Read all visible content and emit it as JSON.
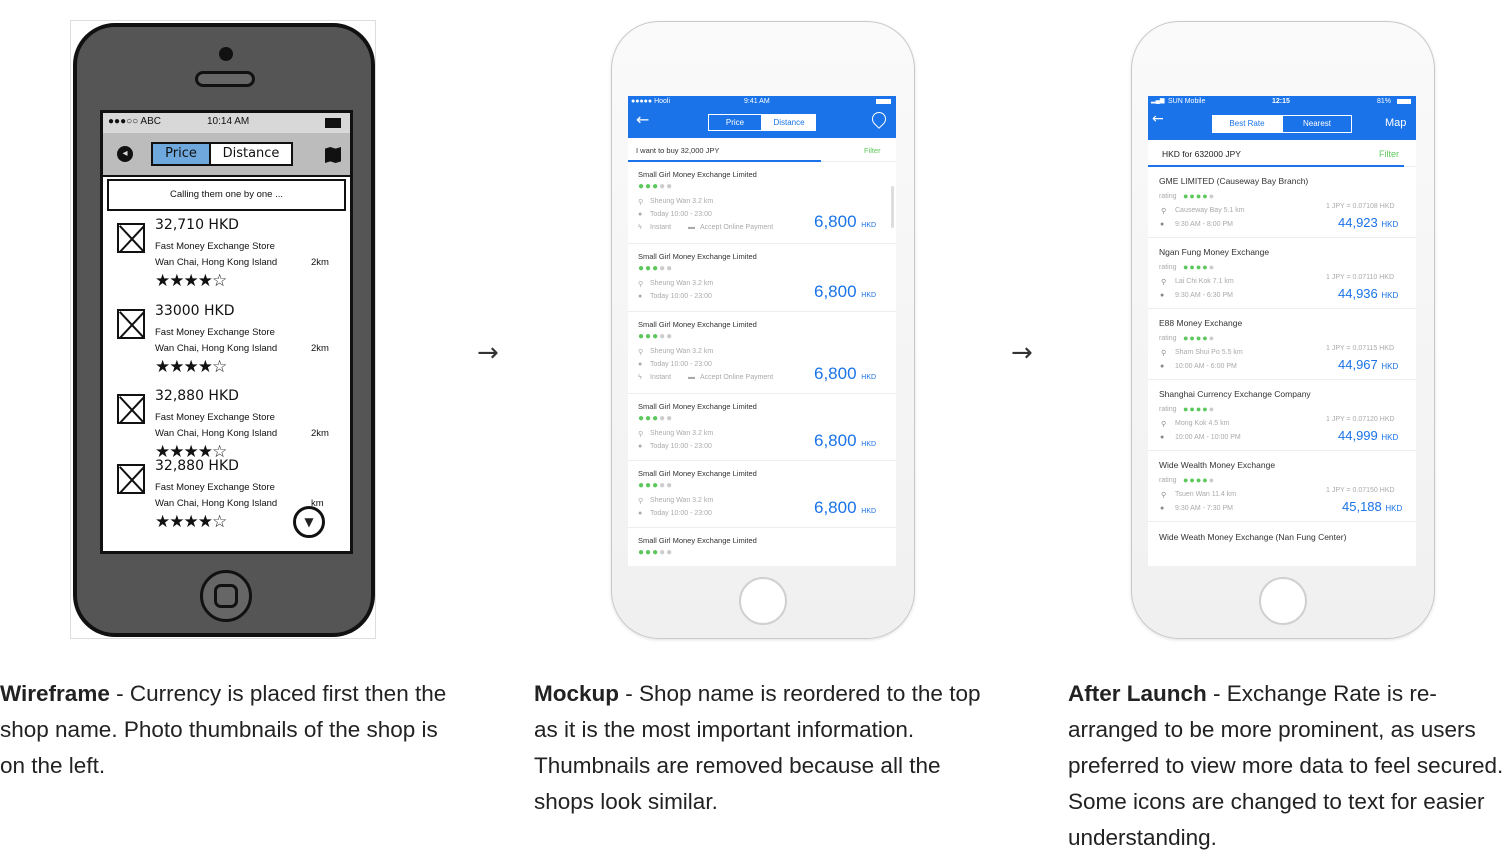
{
  "arrows": [
    "→",
    "→"
  ],
  "wireframe": {
    "status": {
      "carrier": "●●●○○ ABC",
      "time": "10:14 AM",
      "battery": "▭"
    },
    "tabs": {
      "price": "Price",
      "distance": "Distance"
    },
    "search_text": "Calling them one by one ...",
    "items": [
      {
        "price": "32,710 HKD",
        "shop": "Fast Money Exchange Store",
        "location": "Wan Chai, Hong Kong Island",
        "distance": "2km",
        "stars": "★★★★☆"
      },
      {
        "price": "33000 HKD",
        "shop": "Fast Money Exchange Store",
        "location": "Wan Chai, Hong Kong Island",
        "distance": "2km",
        "stars": "★★★★☆"
      },
      {
        "price": "32,880 HKD",
        "shop": "Fast Money Exchange Store",
        "location": "Wan Chai, Hong Kong Island",
        "distance": "2km",
        "stars": "★★★★☆"
      },
      {
        "price": "32,880 HKD",
        "shop": "Fast Money Exchange Store",
        "location": "Wan Chai, Hong Kong Island",
        "distance": "km",
        "stars": "★★★★☆"
      }
    ]
  },
  "mockup": {
    "status": {
      "carrier": "●●●●● Hooli",
      "time": "9:41 AM"
    },
    "tabs": {
      "price": "Price",
      "distance": "Distance"
    },
    "search": {
      "text": "I want to buy 32,000 JPY",
      "filter": "Filter"
    },
    "shop_name": "Small Girl Money Exchange Limited",
    "location": "Sheung Wan 3.2 km",
    "hours": "Today 10:00 - 23:00",
    "instant": "Instant",
    "online": "Accept Online Payment",
    "amount": "6,800",
    "currency": "HKD"
  },
  "after": {
    "status": {
      "carrier": "SUN Mobile",
      "time": "12:15",
      "battery": "81%"
    },
    "tabs": {
      "best": "Best Rate",
      "nearest": "Nearest"
    },
    "map": "Map",
    "search": {
      "text": "HKD for 632000 JPY",
      "filter": "Filter"
    },
    "rating_label": "rating",
    "items": [
      {
        "name": "GME LIMITED (Causeway Bay Branch)",
        "loc": "Causeway Bay 5.1 km",
        "hours": "9:30 AM - 8:00 PM",
        "rate": "1 JPY = 0.07108 HKD",
        "amount": "44,923",
        "cur": "HKD"
      },
      {
        "name": "Ngan Fung Money Exchange",
        "loc": "Lai Chi Kok 7.1 km",
        "hours": "9:30 AM - 6:30 PM",
        "rate": "1 JPY = 0.07110 HKD",
        "amount": "44,936",
        "cur": "HKD"
      },
      {
        "name": "E88 Money Exchange",
        "loc": "Sham Shui Po 5.5 km",
        "hours": "10:00 AM - 6:00 PM",
        "rate": "1 JPY = 0.07115 HKD",
        "amount": "44,967",
        "cur": "HKD"
      },
      {
        "name": "Shanghai Currency Exchange Company",
        "loc": "Mong Kok 4.5 km",
        "hours": "10:00 AM - 10:00 PM",
        "rate": "1 JPY = 0.07120 HKD",
        "amount": "44,999",
        "cur": "HKD"
      },
      {
        "name": "Wide Wealth Money Exchange",
        "loc": "Tsuen Wan 11.4 km",
        "hours": "9:30 AM - 7:30 PM",
        "rate": "1 JPY = 0.07150 HKD",
        "amount": "45,188",
        "cur": "HKD"
      }
    ],
    "last_item": "Wide Weath Money Exchange (Nan Fung Center)"
  },
  "captions": {
    "wireframe": {
      "title": "Wireframe",
      "text": " - Currency is placed first then the shop name. Photo thumbnails of the shop is on the left."
    },
    "mockup": {
      "title": "Mockup",
      "text": " - Shop name is reordered to the top as it is the most important information. Thumbnails are removed because all the shops look similar."
    },
    "after": {
      "title": "After Launch",
      "text": " - Exchange Rate is re-arranged to be more prominent, as users preferred to view more data to feel secured. Some icons are changed to text for easier understanding."
    }
  },
  "colors": {
    "accent": "#1a73e8",
    "green": "#5cc85c"
  }
}
